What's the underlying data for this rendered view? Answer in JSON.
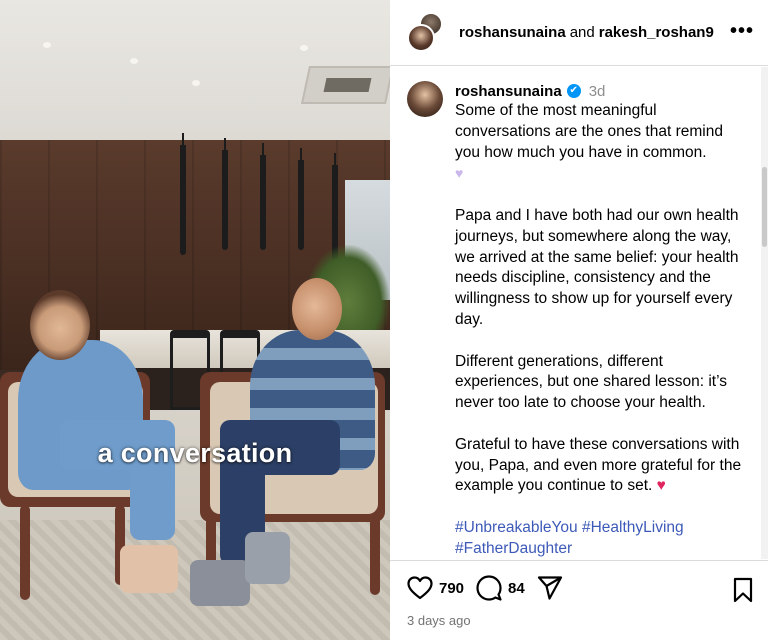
{
  "video": {
    "caption": "a conversation"
  },
  "header": {
    "user1": "roshansunaina",
    "conjunction": "and",
    "user2": "rakesh_roshan9",
    "more_icon": "more-horizontal-icon"
  },
  "comment": {
    "username": "roshansunaina",
    "verified": "✔",
    "time": "3d",
    "paragraphs": [
      "Some of the most meaningful conversations are the ones that remind you how much you have in common.",
      "Papa and I have both had our own health journeys, but somewhere along the way, we arrived at the same belief: your health needs discipline, consistency and the willingness to show up for yourself every day.",
      "Different generations, different experiences, but one shared lesson: it’s never too late to choose your health.",
      "Grateful to have these conversations with you, Papa, and even more grateful for the example you continue to set."
    ],
    "heart_lavender": "♥",
    "heart_red": "♥",
    "hashtags": [
      "#UnbreakableYou",
      "#HealthyLiving",
      "#FatherDaughter"
    ]
  },
  "actions": {
    "likes": "790",
    "comments": "84",
    "like_icon": "heart-icon",
    "comment_icon": "comment-icon",
    "share_icon": "share-icon",
    "save_icon": "bookmark-icon"
  },
  "date": "3 days ago",
  "colors": {
    "verified": "#0095f6",
    "hashtag": "#3d5ab8",
    "heart": "#e0245e",
    "muted": "#737373"
  }
}
